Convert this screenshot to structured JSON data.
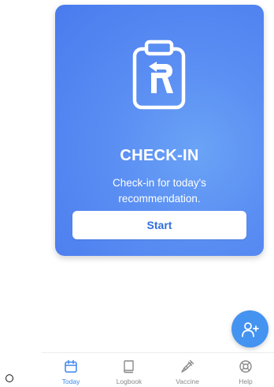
{
  "checkin_card": {
    "title": "CHECK-IN",
    "description": "Check-in for today's recommendation.",
    "start_label": "Start",
    "icon": "clipboard-r-icon"
  },
  "fab": {
    "icon": "add-person-icon"
  },
  "bottom_nav": {
    "items": [
      {
        "label": "Today",
        "icon": "calendar-icon",
        "active": true
      },
      {
        "label": "Logbook",
        "icon": "book-icon",
        "active": false
      },
      {
        "label": "Vaccine",
        "icon": "syringe-icon",
        "active": false
      },
      {
        "label": "Help",
        "icon": "lifebuoy-icon",
        "active": false
      }
    ]
  },
  "colors": {
    "card_blue": "#5b8ff3",
    "accent": "#3b86ee",
    "fab": "#4493f0",
    "inactive": "#8a8a8a"
  }
}
